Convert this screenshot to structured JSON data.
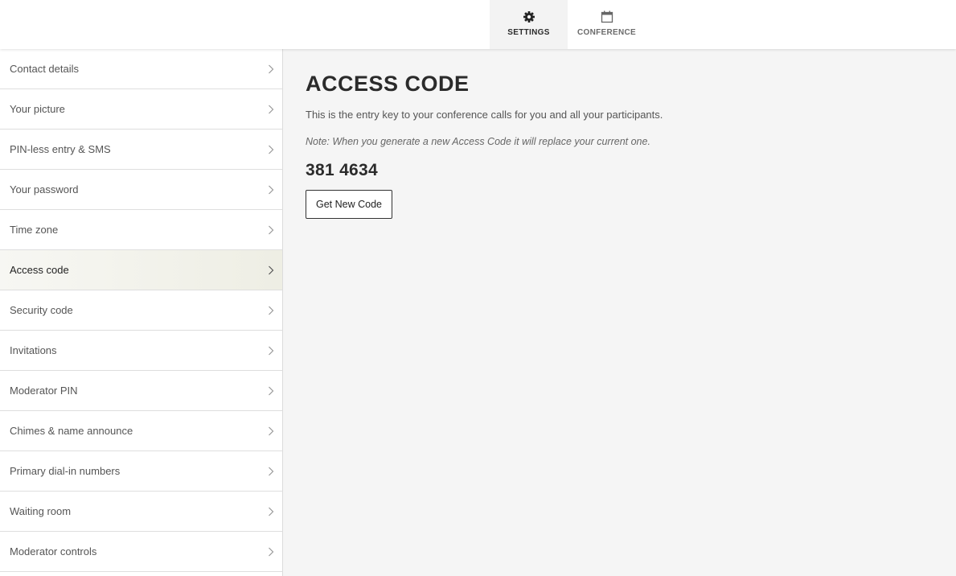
{
  "tabs": [
    {
      "label": "SETTINGS",
      "icon": "gear-icon",
      "active": true
    },
    {
      "label": "CONFERENCE",
      "icon": "calendar-icon",
      "active": false
    }
  ],
  "sidebar": {
    "items": [
      {
        "label": "Contact details"
      },
      {
        "label": "Your picture"
      },
      {
        "label": "PIN-less entry & SMS"
      },
      {
        "label": "Your password"
      },
      {
        "label": "Time zone"
      },
      {
        "label": "Access code",
        "active": true
      },
      {
        "label": "Security code"
      },
      {
        "label": "Invitations"
      },
      {
        "label": "Moderator PIN"
      },
      {
        "label": "Chimes & name announce"
      },
      {
        "label": "Primary dial-in numbers"
      },
      {
        "label": "Waiting room"
      },
      {
        "label": "Moderator controls"
      }
    ]
  },
  "main": {
    "title": "ACCESS CODE",
    "description": "This is the entry key to your conference calls for you and all your participants.",
    "note": "Note: When you generate a new Access Code it will replace your current one.",
    "code": "381 4634",
    "button_label": "Get New Code"
  },
  "colors": {
    "main_background": "#f5f5f5",
    "active_item_background": "#f2f2ea",
    "text_dark": "#2b2b2b"
  }
}
